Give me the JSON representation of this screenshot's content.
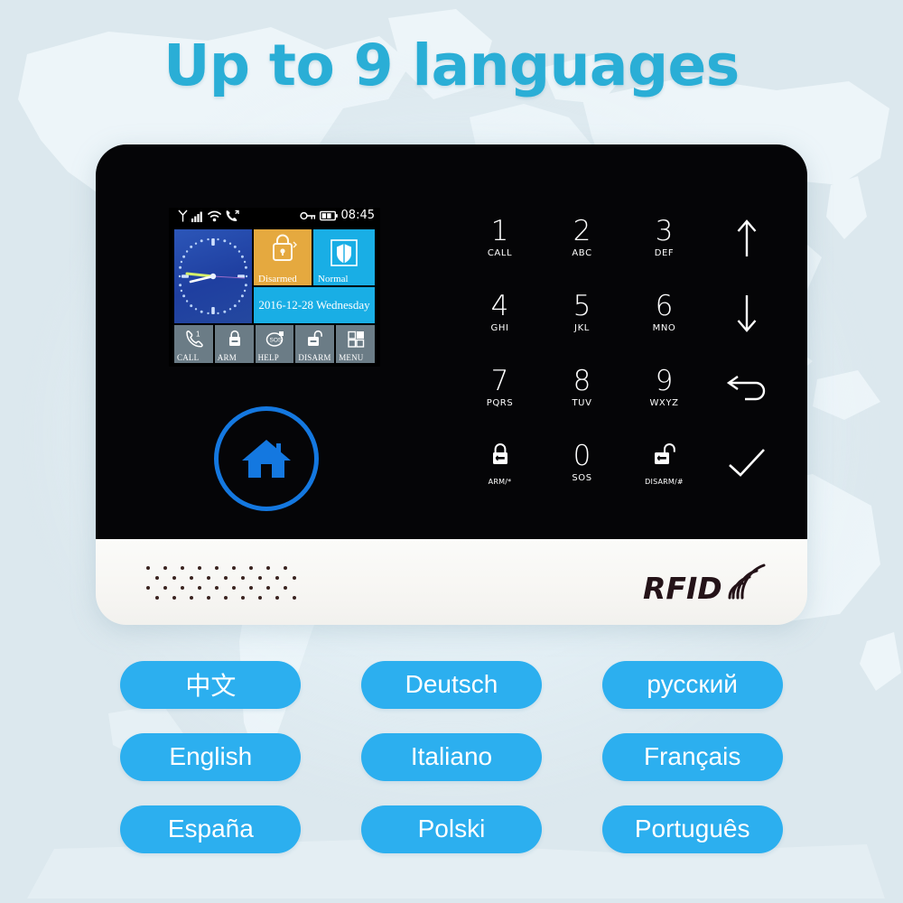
{
  "headline": "Up to 9 languages",
  "colors": {
    "headline": "#2aaed6",
    "pill": "#2cafef",
    "device_black": "#050507",
    "device_white": "#f8f7f4",
    "lcd_blue": "#19aee5",
    "lcd_orange": "#e5a93f",
    "home_ring": "#1478e0",
    "background": "#dfe9ee"
  },
  "device": {
    "brand_logo": "RFID",
    "speaker_grille": "speaker-grille",
    "home_button_icon": "home-icon",
    "lcd": {
      "statusbar": {
        "icons_left": [
          "antenna-icon",
          "signal-bars-icon",
          "wifi-icon",
          "call-forward-icon"
        ],
        "icons_right": [
          "key-icon",
          "battery-icon"
        ],
        "time": "08:45"
      },
      "tiles": {
        "clock": {
          "name": "analog-clock",
          "time": "08:45"
        },
        "status": {
          "label": "Disarmed",
          "icon": "lock-closed-icon"
        },
        "mode": {
          "label": "Normal",
          "icon": "shield-icon"
        },
        "date": {
          "label": "2016-12-28 Wednesday"
        }
      },
      "function_keys": [
        {
          "label": "CALL",
          "icon": "phone-icon"
        },
        {
          "label": "ARM",
          "icon": "lock-closed-icon"
        },
        {
          "label": "HELP",
          "icon": "sos-icon"
        },
        {
          "label": "DISARM",
          "icon": "lock-open-icon"
        },
        {
          "label": "MENU",
          "icon": "grid-icon"
        }
      ]
    },
    "keypad": [
      {
        "digit": "1",
        "sub": "CALL",
        "icon": null
      },
      {
        "digit": "2",
        "sub": "ABC",
        "icon": null
      },
      {
        "digit": "3",
        "sub": "DEF",
        "icon": null
      },
      {
        "digit": null,
        "sub": null,
        "icon": "arrow-up-icon"
      },
      {
        "digit": "4",
        "sub": "GHI",
        "icon": null
      },
      {
        "digit": "5",
        "sub": "JKL",
        "icon": null
      },
      {
        "digit": "6",
        "sub": "MNO",
        "icon": null
      },
      {
        "digit": null,
        "sub": null,
        "icon": "arrow-down-icon"
      },
      {
        "digit": "7",
        "sub": "PQRS",
        "icon": null
      },
      {
        "digit": "8",
        "sub": "TUV",
        "icon": null
      },
      {
        "digit": "9",
        "sub": "WXYZ",
        "icon": null
      },
      {
        "digit": null,
        "sub": null,
        "icon": "back-arrow-icon"
      },
      {
        "digit": null,
        "sub": "ARM/*",
        "icon": "lock-closed-icon"
      },
      {
        "digit": "0",
        "sub": "SOS",
        "icon": null
      },
      {
        "digit": null,
        "sub": "DISARM/#",
        "icon": "lock-open-icon"
      },
      {
        "digit": null,
        "sub": null,
        "icon": "check-icon"
      }
    ]
  },
  "languages": [
    "中文",
    "Deutsch",
    "русский",
    "English",
    "Italiano",
    "Français",
    "España",
    "Polski",
    "Português"
  ]
}
